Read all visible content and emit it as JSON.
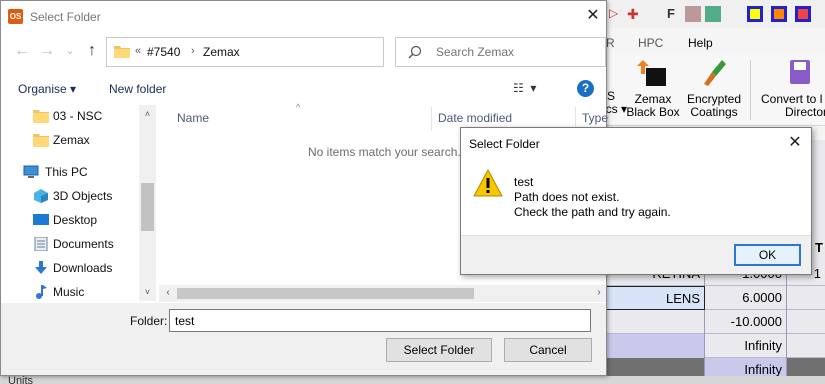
{
  "dialog": {
    "title": "Select Folder",
    "close_label": "✕",
    "address": {
      "overflow": "«",
      "crumbs": [
        "#7540",
        "Zemax"
      ],
      "separator": "›"
    },
    "search_placeholder": "Search Zemax",
    "toolbar": {
      "organise": "Organise ▾",
      "new_folder": "New folder"
    },
    "nav_items": [
      {
        "label": "03 - NSC",
        "icon": "folder-icon"
      },
      {
        "label": "Zemax",
        "icon": "folder-icon"
      },
      {
        "label": "This PC",
        "icon": "computer-icon"
      },
      {
        "label": "3D Objects",
        "icon": "cube-icon"
      },
      {
        "label": "Desktop",
        "icon": "desktop-icon"
      },
      {
        "label": "Documents",
        "icon": "documents-icon"
      },
      {
        "label": "Downloads",
        "icon": "download-icon"
      },
      {
        "label": "Music",
        "icon": "music-icon"
      }
    ],
    "columns": {
      "name": "Name",
      "date_modified": "Date modified",
      "type": "Type"
    },
    "empty_message": "No items match your search.",
    "folder_label": "Folder:",
    "folder_value": "test",
    "select_button": "Select Folder",
    "cancel_button": "Cancel"
  },
  "message_box": {
    "title": "Select Folder",
    "close_label": "✕",
    "lines": [
      "test",
      "Path does not exist.",
      "Check the path and try again."
    ],
    "ok_button": "OK",
    "icon": "warning-icon"
  },
  "background_app": {
    "tabs": [
      "R",
      "HPC",
      "Help"
    ],
    "ribbon_buttons": [
      {
        "line1": "S",
        "line2": "ics ▾"
      },
      {
        "line1": "Zemax",
        "line2": "Black Box"
      },
      {
        "line1": "Encrypted",
        "line2": "Coatings"
      },
      {
        "line1": "Convert to l",
        "line2": "Director"
      }
    ],
    "grid_rows": [
      {
        "col1": "RETINA",
        "col2": "1.0000",
        "col3": "1"
      },
      {
        "col1": "LENS",
        "col2": "6.0000",
        "col3": ""
      },
      {
        "col1": "",
        "col2": "-10.0000",
        "col3": ""
      },
      {
        "col1": "",
        "col2": "Infinity",
        "col3": ""
      },
      {
        "col1": "",
        "col2": "Infinity",
        "col3": ""
      }
    ],
    "header_letter": "T",
    "units_label": "Units"
  },
  "colors": {
    "accent": "#2a78d4",
    "warning": "#f7c800",
    "link": "#1a2a5a"
  }
}
